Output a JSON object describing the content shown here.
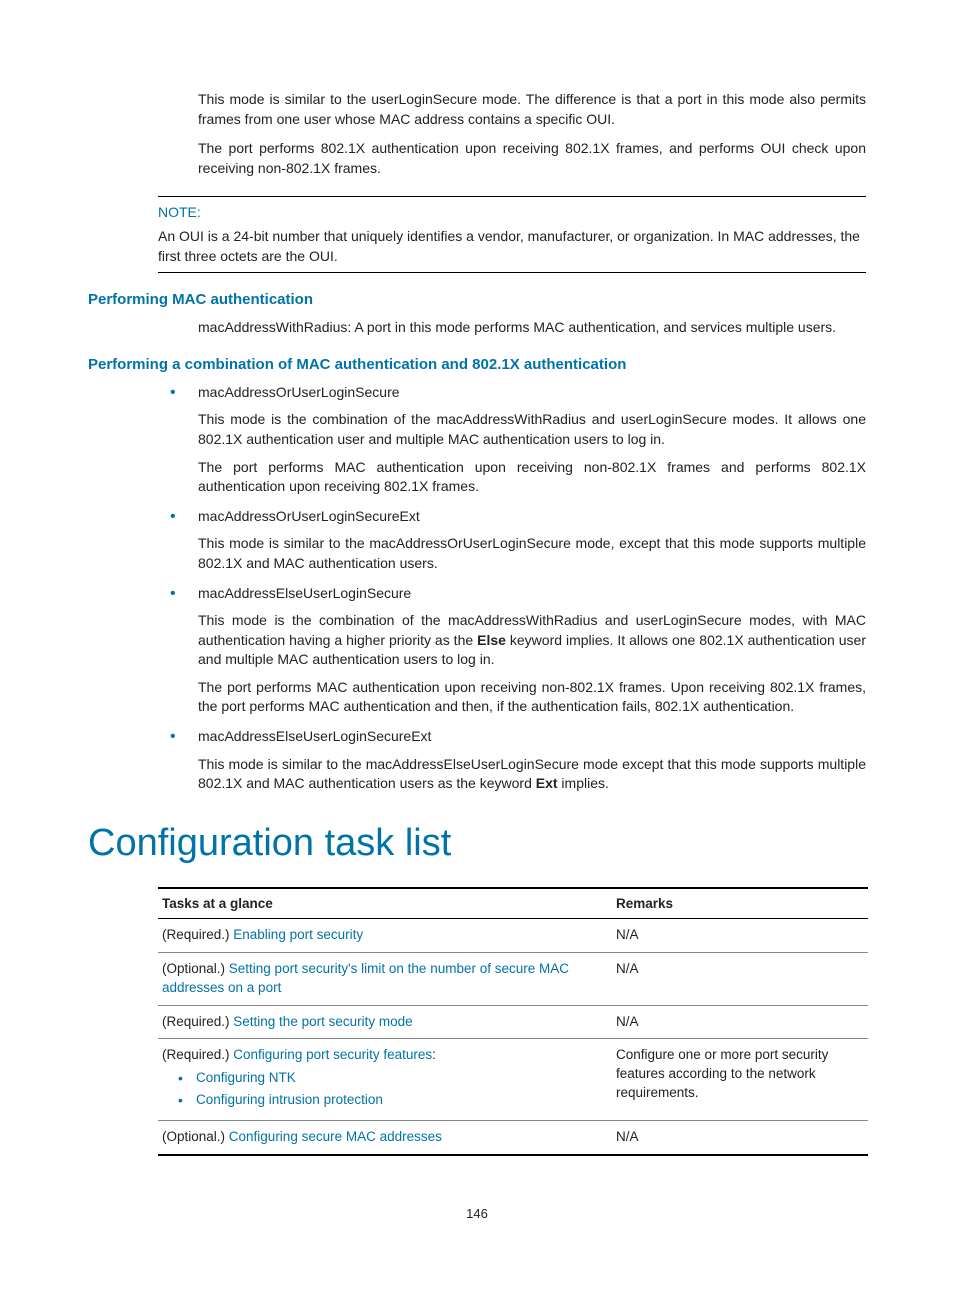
{
  "intro": {
    "p1": "This mode is similar to the userLoginSecure mode. The difference is that a port in this mode also permits frames from one user whose MAC address contains a specific OUI.",
    "p2": "The port performs 802.1X authentication upon receiving 802.1X frames, and performs OUI check upon receiving non-802.1X frames."
  },
  "note": {
    "label": "NOTE:",
    "body": "An OUI is a 24-bit number that uniquely identifies a vendor, manufacturer, or organization. In MAC addresses, the first three octets are the OUI."
  },
  "mac_auth": {
    "heading": "Performing MAC authentication",
    "body": "macAddressWithRadius: A port in this mode performs MAC authentication, and services multiple users."
  },
  "combo": {
    "heading": "Performing a combination of MAC authentication and 802.1X authentication",
    "items": [
      {
        "title": "macAddressOrUserLoginSecure",
        "p1": "This mode is the combination of the macAddressWithRadius and userLoginSecure modes. It allows one 802.1X authentication user and multiple MAC authentication users to log in.",
        "p2": "The port performs MAC authentication upon receiving non-802.1X frames and performs 802.1X authentication upon receiving 802.1X frames."
      },
      {
        "title": "macAddressOrUserLoginSecureExt",
        "p1": "This mode is similar to the macAddressOrUserLoginSecure mode, except that this mode supports multiple 802.1X and MAC authentication users."
      },
      {
        "title": "macAddressElseUserLoginSecure",
        "p1_a": "This mode is the combination of the macAddressWithRadius and userLoginSecure modes, with MAC authentication having a higher priority as the ",
        "p1_b": "Else",
        "p1_c": " keyword implies. It allows one 802.1X authentication user and multiple MAC authentication users to log in.",
        "p2": "The port performs MAC authentication upon receiving non-802.1X frames. Upon receiving 802.1X frames, the port performs MAC authentication and then, if the authentication fails, 802.1X authentication."
      },
      {
        "title": "macAddressElseUserLoginSecureExt",
        "p1_a": "This mode is similar to the macAddressElseUserLoginSecure mode except that this mode supports multiple 802.1X and MAC authentication users as the keyword ",
        "p1_b": "Ext",
        "p1_c": " implies."
      }
    ]
  },
  "task_list": {
    "heading": "Configuration task list",
    "headers": {
      "tasks": "Tasks at a glance",
      "remarks": "Remarks"
    },
    "rows": [
      {
        "prefix": "(Required.) ",
        "link": "Enabling port security",
        "remarks": "N/A"
      },
      {
        "prefix": "(Optional.) ",
        "link": "Setting port security's limit on the number of secure MAC addresses on a port",
        "remarks": "N/A"
      },
      {
        "prefix": "(Required.) ",
        "link": "Setting the port security mode",
        "remarks": "N/A"
      },
      {
        "prefix": "(Required.) ",
        "link": "Configuring port security features",
        "suffix": ":",
        "sub": [
          "Configuring NTK",
          "Configuring intrusion protection"
        ],
        "remarks": "Configure one or more port security features according to the network requirements."
      },
      {
        "prefix": "(Optional.) ",
        "link": "Configuring secure MAC addresses",
        "remarks": "N/A"
      }
    ]
  },
  "page_number": "146"
}
